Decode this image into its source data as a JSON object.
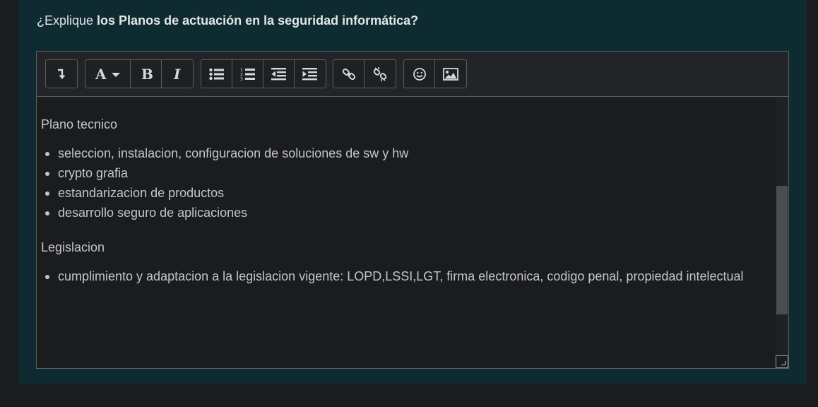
{
  "question": {
    "prefix": "¿Explique ",
    "bold": "los Planos de actuación en la seguridad informática?"
  },
  "toolbar": {
    "groups": [
      [
        "expand-icon"
      ],
      [
        "font-icon",
        "bold-icon",
        "italic-icon"
      ],
      [
        "bullet-list-icon",
        "numbered-list-icon",
        "outdent-icon",
        "indent-icon"
      ],
      [
        "link-icon",
        "unlink-icon"
      ],
      [
        "emoji-icon",
        "image-icon"
      ]
    ]
  },
  "content": {
    "section1_title": "Plano tecnico",
    "section1_items": [
      "seleccion, instalacion, configuracion de soluciones de sw y hw",
      "crypto grafia",
      "estandarizacion de productos",
      "desarrollo seguro de aplicaciones"
    ],
    "section2_title": "Legislacion",
    "section2_items": [
      "cumplimiento y adaptacion a la legislacion vigente: LOPD,LSSI,LGT, firma electronica, codigo penal, propiedad intelectual"
    ]
  },
  "colors": {
    "card_background": "#0f2b32",
    "page_background": "#1b1c1e",
    "editor_background": "#1b1c1e",
    "toolbar_background": "#232427"
  }
}
